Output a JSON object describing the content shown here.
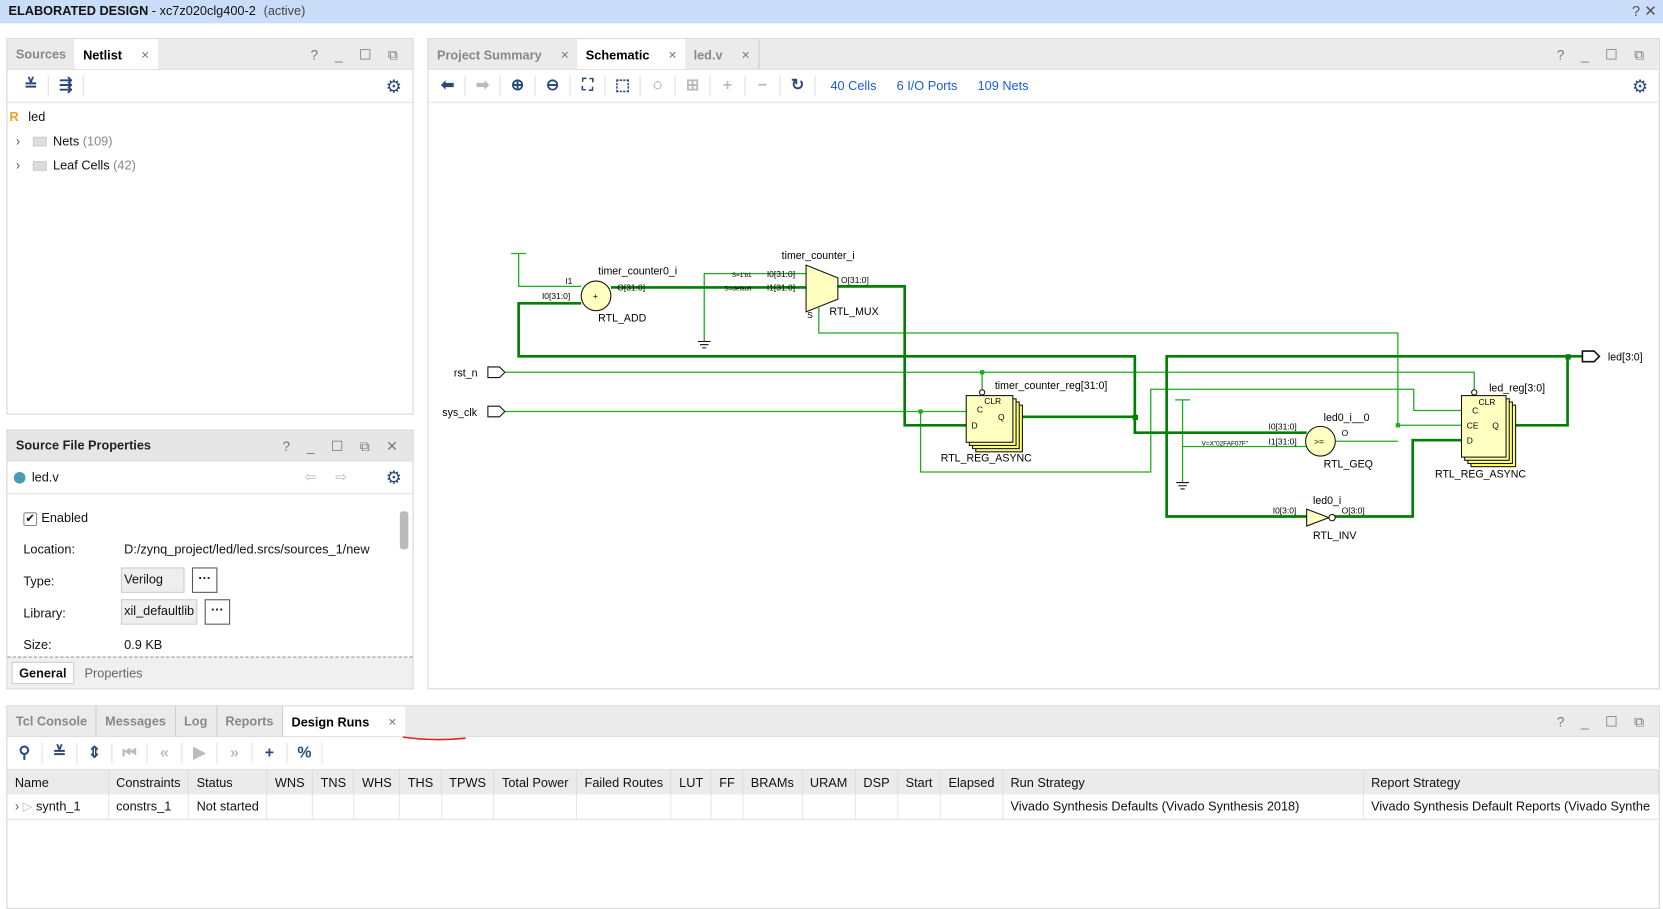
{
  "title": {
    "design": "ELABORATED DESIGN",
    "part": " - xc7z020clg400-2",
    "status": "(active)",
    "help": "?",
    "close": "✕"
  },
  "netlist_panel": {
    "tabs": [
      {
        "label": "Sources"
      },
      {
        "label": "Netlist",
        "active": true
      }
    ],
    "close": "×",
    "controls": "? _ ☐ ⧉",
    "root": {
      "badge": "R",
      "label": "led"
    },
    "items": [
      {
        "label": "Nets",
        "count": "(109)"
      },
      {
        "label": "Leaf Cells",
        "count": "(42)"
      }
    ]
  },
  "source_props": {
    "title": "Source File Properties",
    "controls": "? _ ☐ ⧉ ✕",
    "file": "led.v",
    "file_color": "#4a9bb5",
    "enabled_label": "Enabled",
    "enabled": true,
    "location_label": "Location:",
    "location": "D:/zynq_project/led/led.srcs/sources_1/new",
    "type_label": "Type:",
    "type": "Verilog",
    "library_label": "Library:",
    "library": "xil_defaultlib",
    "size_label": "Size:",
    "size": "0.9 KB",
    "more": "···",
    "tabs": [
      {
        "label": "General",
        "active": true
      },
      {
        "label": "Properties"
      }
    ]
  },
  "schematic_panel": {
    "tabs": [
      {
        "label": "Project Summary"
      },
      {
        "label": "Schematic",
        "active": true
      },
      {
        "label": "led.v"
      }
    ],
    "close": "×",
    "controls": "? _ ☐ ⧉",
    "stats": {
      "cells": "40 Cells",
      "ports": "6 I/O Ports",
      "nets": "109 Nets"
    },
    "wire_color": "#008000",
    "net_color": "#1cac1c",
    "cell_fill": "#ffffc0",
    "labels": {
      "adder_name": "timer_counter0_i",
      "adder_type": "RTL_ADD",
      "adder_i1": "I1",
      "adder_i0": "I0[31:0]",
      "adder_o": "O[31:0]",
      "adder_sym": "+",
      "mux_name": "timer_counter_i",
      "mux_type": "RTL_MUX",
      "mux_i0": "I0[31:0]",
      "mux_i1": "I1[31:0]",
      "mux_o": "O[31:0]",
      "mux_s": "S",
      "mux_s1": "S=1'b1",
      "mux_sd": "S=default",
      "rst": "rst_n",
      "clk": "sys_clk",
      "led": "led[3:0]",
      "reg1_name": "timer_counter_reg[31:0]",
      "reg_type": "RTL_REG_ASYNC",
      "clr": "CLR",
      "c": "C",
      "d": "D",
      "q": "Q",
      "ce": "CE",
      "geq_name": "led0_i__0",
      "geq_type": "RTL_GEQ",
      "geq_i0": "I0[31:0]",
      "geq_i1": "I1[31:0]",
      "geq_o": "O",
      "geq_sym": ">=",
      "geq_const": "V=X\"02FAF07F\"",
      "reg2_name": "led_reg[3:0]",
      "inv_name": "led0_i",
      "inv_type": "RTL_INV",
      "inv_i0": "I0[3:0]",
      "inv_o": "O[3:0]"
    }
  },
  "bottom_panel": {
    "tabs": [
      {
        "label": "Tcl Console"
      },
      {
        "label": "Messages"
      },
      {
        "label": "Log"
      },
      {
        "label": "Reports"
      },
      {
        "label": "Design Runs",
        "active": true
      }
    ],
    "close": "×",
    "controls": "? _ ☐ ⧉",
    "columns": [
      "Name",
      "Constraints",
      "Status",
      "WNS",
      "TNS",
      "WHS",
      "THS",
      "TPWS",
      "Total Power",
      "Failed Routes",
      "LUT",
      "FF",
      "BRAMs",
      "URAM",
      "DSP",
      "Start",
      "Elapsed",
      "Run Strategy",
      "Report Strategy"
    ],
    "rows": [
      {
        "name": "synth_1",
        "constraints": "constrs_1",
        "status": "Not started",
        "run_strategy": "Vivado Synthesis Defaults (Vivado Synthesis 2018)",
        "report_strategy": "Vivado Synthesis Default Reports (Vivado Synthe"
      }
    ]
  }
}
